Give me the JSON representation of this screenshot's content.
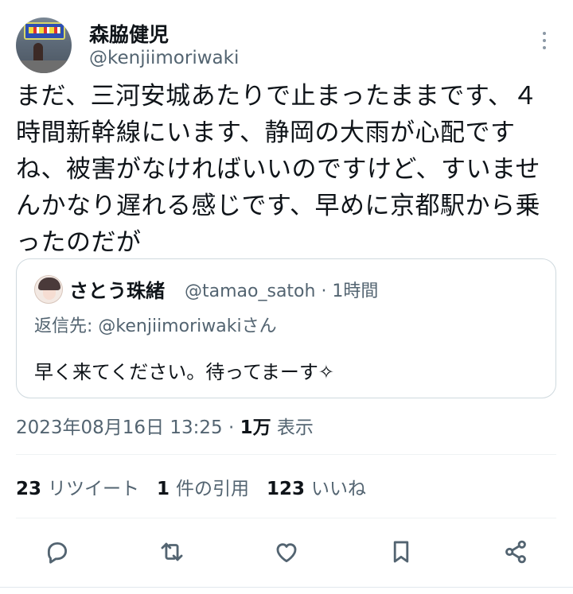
{
  "author": {
    "name": "森脇健児",
    "handle": "@kenjiimoriwaki"
  },
  "tweet": {
    "text": "まだ、三河安城あたりで止まったままです、４時間新幹線にいます、静岡の大雨が心配ですね、被害がなければいいのですけど、すいませんかなり遅れる感じです、早めに京都駅から乗ったのだが",
    "timestamp": "2023年08月16日 13:25",
    "separator": " · ",
    "views_count": "1万",
    "views_label": " 表示"
  },
  "quote": {
    "name": "さとう珠緒",
    "meta": "@tamao_satoh · 1時間",
    "reply_prefix": "返信先: ",
    "reply_mention": "@kenjiimoriwaki",
    "reply_suffix": "さん",
    "text": "早く来てください。待ってまーす✧"
  },
  "stats": {
    "retweets_count": "23",
    "retweets_label": "リツイート",
    "quotes_count": "1",
    "quotes_label": "件の引用",
    "likes_count": "123",
    "likes_label": "いいね"
  },
  "icons": {
    "reply": "reply-icon",
    "retweet": "retweet-icon",
    "like": "heart-icon",
    "bookmark": "bookmark-icon",
    "share": "share-icon",
    "more": "more-icon"
  },
  "colors": {
    "text": "#0f1419",
    "secondary": "#536471",
    "border": "#cfd9de"
  }
}
